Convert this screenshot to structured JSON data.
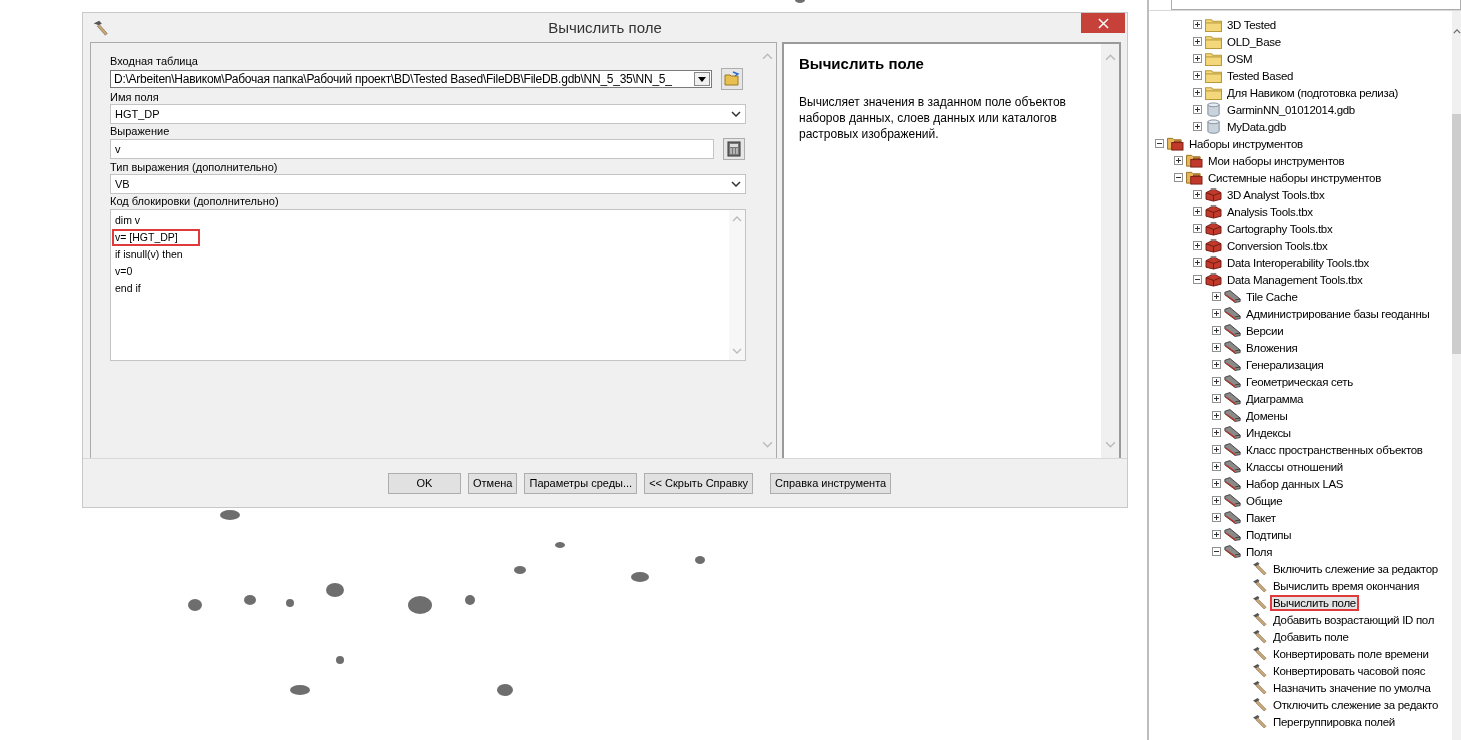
{
  "dialog": {
    "title": "Вычислить поле",
    "fields": [
      {
        "kind": "combo",
        "label": "Входная таблица",
        "value": "D:\\Arbeiten\\Навиком\\Рабочая папка\\Рабочий проект\\BD\\Tested Based\\FileDB\\FileDB.gdb\\NN_5_35\\NN_5_"
      },
      {
        "kind": "dropdown",
        "label": "Имя поля",
        "value": "HGT_DP"
      },
      {
        "kind": "calc",
        "label": "Выражение",
        "value": "v"
      },
      {
        "kind": "dropdown",
        "label": "Тип выражения (дополнительно)",
        "value": "VB"
      },
      {
        "kind": "code",
        "label": "Код блокировки (дополнительно)",
        "lines": [
          {
            "text": "dim v",
            "annotated": false
          },
          {
            "text": "v= [HGT_DP]",
            "annotated": true
          },
          {
            "text": "if isnull(v) then",
            "annotated": false
          },
          {
            "text": "v=0",
            "annotated": false
          },
          {
            "text": "end if",
            "annotated": false
          }
        ]
      }
    ],
    "help": {
      "title": "Вычислить поле",
      "text": "Вычисляет значения в заданном поле объектов наборов данных, слоев данных или каталогов растровых изображений."
    },
    "buttons": [
      "OK",
      "Отмена",
      "Параметры среды...",
      "<< Скрыть Справку"
    ],
    "extra_buttons": [
      "Справка инструмента"
    ]
  },
  "catalog": {
    "partial_group": [
      {
        "kind": "folder",
        "label": "3D Tested",
        "expanded": false,
        "selected": false,
        "annotated": false
      },
      {
        "kind": "folder",
        "label": "OLD_Base",
        "expanded": false,
        "selected": false,
        "annotated": false
      },
      {
        "kind": "folder",
        "label": "OSM",
        "expanded": false,
        "selected": false,
        "annotated": false
      },
      {
        "kind": "folder",
        "label": "Tested Based",
        "expanded": false,
        "selected": false,
        "annotated": false
      },
      {
        "kind": "folder",
        "label": "Для Навиком (подготовка релиза)",
        "expanded": false,
        "selected": false,
        "annotated": false
      },
      {
        "kind": "gdb",
        "label": "GarminNN_01012014.gdb",
        "expanded": false,
        "selected": false,
        "annotated": false
      },
      {
        "kind": "gdb",
        "label": "MyData.gdb",
        "expanded": false,
        "selected": false,
        "annotated": false
      }
    ],
    "items": [
      {
        "kind": "toolbox_group",
        "label": "Наборы инструментов",
        "expanded": true,
        "selected": false,
        "annotated": false,
        "children": [
          {
            "kind": "toolbox_group",
            "label": "Мои наборы инструментов",
            "expanded": false,
            "selected": false,
            "annotated": false
          },
          {
            "kind": "toolbox_group",
            "label": "Системные наборы инструментов",
            "expanded": true,
            "selected": false,
            "annotated": false,
            "children": [
              {
                "kind": "toolbox",
                "label": "3D Analyst Tools.tbx",
                "expanded": false,
                "selected": false,
                "annotated": false
              },
              {
                "kind": "toolbox",
                "label": "Analysis Tools.tbx",
                "expanded": false,
                "selected": false,
                "annotated": false
              },
              {
                "kind": "toolbox",
                "label": "Cartography Tools.tbx",
                "expanded": false,
                "selected": false,
                "annotated": false
              },
              {
                "kind": "toolbox",
                "label": "Conversion Tools.tbx",
                "expanded": false,
                "selected": false,
                "annotated": false
              },
              {
                "kind": "toolbox",
                "label": "Data Interoperability Tools.tbx",
                "expanded": false,
                "selected": false,
                "annotated": false
              },
              {
                "kind": "toolbox",
                "label": "Data Management Tools.tbx",
                "expanded": true,
                "selected": false,
                "annotated": false,
                "children": [
                  {
                    "kind": "toolset",
                    "label": "Tile Cache",
                    "expanded": false,
                    "selected": false,
                    "annotated": false
                  },
                  {
                    "kind": "toolset",
                    "label": "Администрирование базы геоданны",
                    "expanded": false,
                    "selected": false,
                    "annotated": false
                  },
                  {
                    "kind": "toolset",
                    "label": "Версии",
                    "expanded": false,
                    "selected": false,
                    "annotated": false
                  },
                  {
                    "kind": "toolset",
                    "label": "Вложения",
                    "expanded": false,
                    "selected": false,
                    "annotated": false
                  },
                  {
                    "kind": "toolset",
                    "label": "Генерализация",
                    "expanded": false,
                    "selected": false,
                    "annotated": false
                  },
                  {
                    "kind": "toolset",
                    "label": "Геометрическая сеть",
                    "expanded": false,
                    "selected": false,
                    "annotated": false
                  },
                  {
                    "kind": "toolset",
                    "label": "Диаграмма",
                    "expanded": false,
                    "selected": false,
                    "annotated": false
                  },
                  {
                    "kind": "toolset",
                    "label": "Домены",
                    "expanded": false,
                    "selected": false,
                    "annotated": false
                  },
                  {
                    "kind": "toolset",
                    "label": "Индексы",
                    "expanded": false,
                    "selected": false,
                    "annotated": false
                  },
                  {
                    "kind": "toolset",
                    "label": "Класс пространственных объектов",
                    "expanded": false,
                    "selected": false,
                    "annotated": false
                  },
                  {
                    "kind": "toolset",
                    "label": "Классы отношений",
                    "expanded": false,
                    "selected": false,
                    "annotated": false
                  },
                  {
                    "kind": "toolset",
                    "label": "Набор данных LAS",
                    "expanded": false,
                    "selected": false,
                    "annotated": false
                  },
                  {
                    "kind": "toolset",
                    "label": "Общие",
                    "expanded": false,
                    "selected": false,
                    "annotated": false
                  },
                  {
                    "kind": "toolset",
                    "label": "Пакет",
                    "expanded": false,
                    "selected": false,
                    "annotated": false
                  },
                  {
                    "kind": "toolset",
                    "label": "Подтипы",
                    "expanded": false,
                    "selected": false,
                    "annotated": false
                  },
                  {
                    "kind": "toolset",
                    "label": "Поля",
                    "expanded": true,
                    "selected": false,
                    "annotated": false,
                    "children": [
                      {
                        "kind": "tool",
                        "label": "Включить слежение за редактор",
                        "selected": false,
                        "annotated": false
                      },
                      {
                        "kind": "tool",
                        "label": "Вычислить время окончания",
                        "selected": false,
                        "annotated": false
                      },
                      {
                        "kind": "tool",
                        "label": "Вычислить поле",
                        "selected": true,
                        "annotated": true
                      },
                      {
                        "kind": "tool",
                        "label": "Добавить возрастающий ID пол",
                        "selected": false,
                        "annotated": false
                      },
                      {
                        "kind": "tool",
                        "label": "Добавить поле",
                        "selected": false,
                        "annotated": false
                      },
                      {
                        "kind": "tool",
                        "label": "Конвертировать поле времени",
                        "selected": false,
                        "annotated": false
                      },
                      {
                        "kind": "tool",
                        "label": "Конвертировать часовой пояс",
                        "selected": false,
                        "annotated": false
                      },
                      {
                        "kind": "tool",
                        "label": "Назначить значение по умолча",
                        "selected": false,
                        "annotated": false
                      },
                      {
                        "kind": "tool",
                        "label": "Отключить слежение за редакто",
                        "selected": false,
                        "annotated": false
                      },
                      {
                        "kind": "tool",
                        "label": "Перегруппировка полей",
                        "selected": false,
                        "annotated": false
                      }
                    ]
                  }
                ]
              }
            ]
          }
        ]
      }
    ]
  }
}
